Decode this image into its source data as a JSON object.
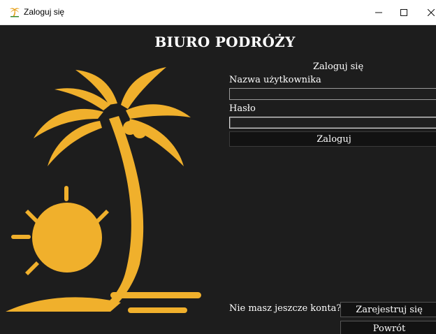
{
  "window": {
    "title": "Zaloguj się",
    "controls": {
      "minimize": "–",
      "maximize": "☐",
      "close": "✕"
    }
  },
  "header": {
    "title": "BIURO PODRÓŻY"
  },
  "login": {
    "heading": "Zaloguj się",
    "username_label": "Nazwa użytkownika",
    "username_value": "",
    "password_label": "Hasło",
    "password_value": "",
    "submit_label": "Zaloguj"
  },
  "footer": {
    "no_account_text": "Nie masz jeszcze konta?",
    "register_label": "Zarejestruj się",
    "back_label": "Powrót"
  },
  "colors": {
    "background": "#1d1d1d",
    "accent": "#f0b02c",
    "text": "#ffffff"
  },
  "icons": {
    "app": "palm-tree-icon",
    "illustration": "palm-tree-sun-beach-illustration"
  }
}
